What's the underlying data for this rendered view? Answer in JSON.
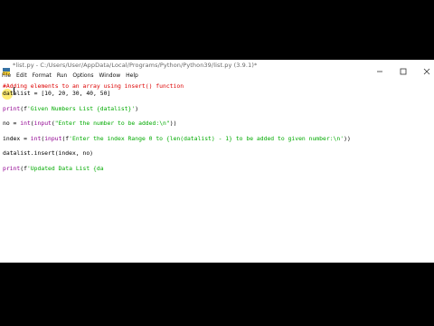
{
  "window": {
    "title": "*list.py - C:/Users/User/AppData/Local/Programs/Python/Python39/list.py (3.9.1)*"
  },
  "menu": {
    "items": [
      "File",
      "Edit",
      "Format",
      "Run",
      "Options",
      "Window",
      "Help"
    ]
  },
  "editor": {
    "lines": [
      {
        "segments": [
          {
            "t": "#Adding elements to an array using insert() function",
            "c": "cmt"
          }
        ]
      },
      {
        "segments": [
          {
            "t": "datalist = [10, 20, 30, 40, 50]",
            "c": "txt"
          }
        ]
      },
      {
        "segments": []
      },
      {
        "segments": [
          {
            "t": "print",
            "c": "kw"
          },
          {
            "t": "(f",
            "c": "txt"
          },
          {
            "t": "'Given Numbers List {datalist}'",
            "c": "str"
          },
          {
            "t": ")",
            "c": "txt"
          }
        ]
      },
      {
        "segments": []
      },
      {
        "segments": [
          {
            "t": "no = ",
            "c": "txt"
          },
          {
            "t": "int",
            "c": "kw"
          },
          {
            "t": "(",
            "c": "txt"
          },
          {
            "t": "input",
            "c": "kw"
          },
          {
            "t": "(",
            "c": "txt"
          },
          {
            "t": "\"Enter the number to be added:\\n\"",
            "c": "str"
          },
          {
            "t": "))",
            "c": "txt"
          }
        ]
      },
      {
        "segments": []
      },
      {
        "segments": [
          {
            "t": "index = ",
            "c": "txt"
          },
          {
            "t": "int",
            "c": "kw"
          },
          {
            "t": "(",
            "c": "txt"
          },
          {
            "t": "input",
            "c": "kw"
          },
          {
            "t": "(f",
            "c": "txt"
          },
          {
            "t": "'Enter the index Range 0 to {len(datalist) - 1} to be added to given number:\\n'",
            "c": "str"
          },
          {
            "t": "))",
            "c": "txt"
          }
        ]
      },
      {
        "segments": []
      },
      {
        "segments": [
          {
            "t": "datalist.insert(index, no)",
            "c": "txt"
          }
        ]
      },
      {
        "segments": []
      },
      {
        "segments": [
          {
            "t": "print",
            "c": "kw"
          },
          {
            "t": "(f",
            "c": "txt"
          },
          {
            "t": "'Updated Data List {da",
            "c": "str"
          }
        ]
      }
    ]
  },
  "colors": {
    "keyword": "#900090",
    "string": "#00aa00",
    "comment": "#dd0000",
    "background": "#ffffff",
    "letterbox": "#000000"
  },
  "icons": {
    "app": "python-idle-icon",
    "minimize": "minimize-icon",
    "maximize": "maximize-icon",
    "close": "close-icon"
  }
}
